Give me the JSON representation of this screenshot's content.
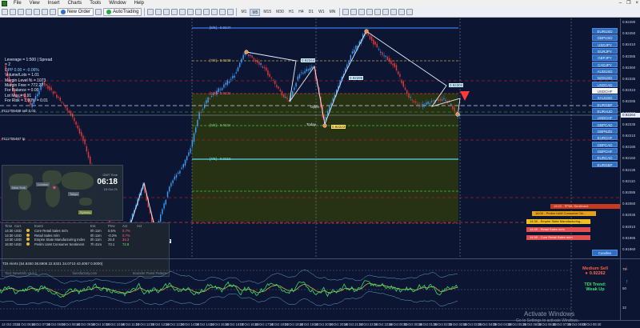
{
  "menubar": {
    "items": [
      "File",
      "View",
      "Insert",
      "Charts",
      "Tools",
      "Window",
      "Help"
    ]
  },
  "toolbar": {
    "new_order_label": "New Order",
    "autotrading_label": "AutoTrading",
    "timeframes": [
      "M1",
      "M5",
      "M15",
      "M30",
      "H1",
      "H4",
      "D1",
      "W1",
      "MN"
    ],
    "active_timeframe": "M5"
  },
  "info_panel": {
    "leverage": "Leverage = 1:500 | Spread = 2",
    "daily_profit": "DPP 0.00 = -0.06%",
    "volume": "Volume/Lots = 1.01",
    "equity": "Margin Level % = 1073",
    "margin": "Margin Free = 772.27",
    "for_balance": "For Balance = 0.00",
    "lot_max": "Lot Max = 0.91",
    "for_risk": "For Risk = 1.00% = 0.01",
    "trade_label_1": "#111705488 sell 0.03",
    "trade_label_2": "#111705487 tp"
  },
  "murrey_levels": [
    {
      "label": "[8/8] - 0.9247"
    },
    {
      "label": "[7/8] - 0.9239"
    },
    {
      "label": "[6/8] - 0.9232"
    },
    {
      "label": "[5/8] - 0.9224"
    },
    {
      "label": "[4/8] - 0.9216"
    }
  ],
  "chart_tags": {
    "high_tag": "0.92344",
    "mid_tag": "0.92286",
    "right_tag": "0.92304",
    "low_tag": "0.92223",
    "left_tag": "0.92157",
    "open_label": "Open",
    "today_label": "Today"
  },
  "world_clock": {
    "label": "GMT Time",
    "time": "06:18",
    "sub": "15 Oct 21",
    "cities": [
      "New York",
      "London",
      "Tokyo",
      "Sydney"
    ]
  },
  "news": {
    "headers": [
      "Time",
      "Curr.",
      "Event",
      "Est.",
      "Prev",
      "Act",
      "Act"
    ],
    "rows": [
      {
        "time": "14:30",
        "curr": "USD",
        "event": "Core Retail Sales m/m",
        "est": "0h 11m",
        "prev": "0.5%",
        "act": "0.7%"
      },
      {
        "time": "14:30",
        "curr": "USD",
        "event": "Retail Sales m/m",
        "est": "0h 11m",
        "prev": "-0.2%",
        "act": "0.7%"
      },
      {
        "time": "14:30",
        "curr": "USD",
        "event": "Empire State Manufacturing Index",
        "est": "0h 11m",
        "prev": "25.0",
        "act": "34.3"
      },
      {
        "time": "16:00",
        "curr": "USD",
        "event": "Prelim UoM Consumer Sentiment",
        "est": "7h 41m",
        "prev": "73.1",
        "act": "72.8"
      }
    ],
    "footer_left": "Tool: NewsInfo v2.7.1",
    "footer_mid": "forexfactory.com",
    "footer_right": "Sounder Panel Pattern"
  },
  "symbols": [
    "EURUSD",
    "GBPUSD",
    "USDJPY",
    "EURJPY",
    "GBPJPY",
    "CADJPY",
    "AUDUSD",
    "NZDUSD",
    "USDCAD",
    "USDCHF",
    "XAUUSD",
    "EURGBP",
    "EURAUD",
    "USDCHF",
    "GBPCAD",
    "GBPNZD",
    "EURCHF",
    "GBPCAD",
    "GBPCHF",
    "EURCAD",
    "EURGBP"
  ],
  "active_symbol_index": 9,
  "candles_button": "Candles",
  "right_boxes": [
    {
      "text": "19:22 - PPML Sentiment",
      "bg": "#c83a20",
      "fg": "#ffd9c0"
    },
    {
      "text": "16:00 - Prelim UoM Consumer Se...",
      "bg": "#e6a01c",
      "fg": "#1a1200"
    },
    {
      "text": "14:30 - Empire State Manufacturing...",
      "bg": "#f0c020",
      "fg": "#1a1200"
    },
    {
      "text": "14:30 - Retail Sales m/m",
      "bg": "#e15050",
      "fg": "#fff0f0"
    },
    {
      "text": "14:30 - Core Retail Sales m/m",
      "bg": "#e15050",
      "fg": "#fff0f0"
    }
  ],
  "price_axis": {
    "ticks": [
      "0.92490",
      "0.92450",
      "0.92410",
      "0.92385",
      "0.92360",
      "0.92335",
      "0.92310",
      "0.92285",
      "0.92260",
      "0.92235",
      "0.92210",
      "0.92185",
      "0.92160",
      "0.92135",
      "0.92110",
      "0.92085",
      "0.92060",
      "0.92035",
      "0.92010",
      "0.91985",
      "0.91960"
    ],
    "current_price": "0.92264"
  },
  "tdi": {
    "title": "TDI Alerts (54.8450 38.6906 22.5321 34.0710 43.4057 0.0000)",
    "signal": "Medium Sell",
    "signal_price": "0.92262",
    "trend_label": "TDI Trend:",
    "trend_value": "Weak Up",
    "axis_ticks": [
      "78",
      "50",
      "32"
    ]
  },
  "time_axis": [
    "14 Oct 2021",
    "14 Oct 06:40",
    "14 Oct 07:20",
    "14 Oct 08:00",
    "14 Oct 08:40",
    "14 Oct 09:20",
    "14 Oct 10:00",
    "14 Oct 10:40",
    "14 Oct 11:20",
    "14 Oct 12:00",
    "14 Oct 12:40",
    "14 Oct 13:20",
    "14 Oct 14:00",
    "14 Oct 14:40",
    "14 Oct 15:20",
    "14 Oct 16:00",
    "14 Oct 16:40",
    "14 Oct 17:20",
    "14 Oct 18:00",
    "14 Oct 18:40",
    "14 Oct 19:20",
    "14 Oct 20:00",
    "14 Oct 20:40",
    "14 Oct 21:20",
    "14 Oct 22:00",
    "14 Oct 22:40",
    "15 Oct 00:00",
    "15 Oct 00:40",
    "15 Oct 01:20",
    "15 Oct 02:00",
    "15 Oct 02:40",
    "15 Oct 03:20",
    "15 Oct 04:00",
    "15 Oct 04:40",
    "15 Oct 05:20",
    "15 Oct 06:00",
    "15 Oct 06:40",
    "15 Oct 07:20",
    "15 Oct 08:00",
    "15 Oct 08:40"
  ],
  "watermark": {
    "line1": "Activate Windows",
    "line2": "Go to Settings to activate Windows."
  },
  "colors": {
    "background": "#0c1632",
    "bull": "#3aa0ff",
    "bear": "#e23a3a",
    "zone": "#2d3a10",
    "sell_arrow": "#ff3a3a",
    "tdi_green": "#33e06a",
    "tdi_yellow": "#e0c84a"
  }
}
